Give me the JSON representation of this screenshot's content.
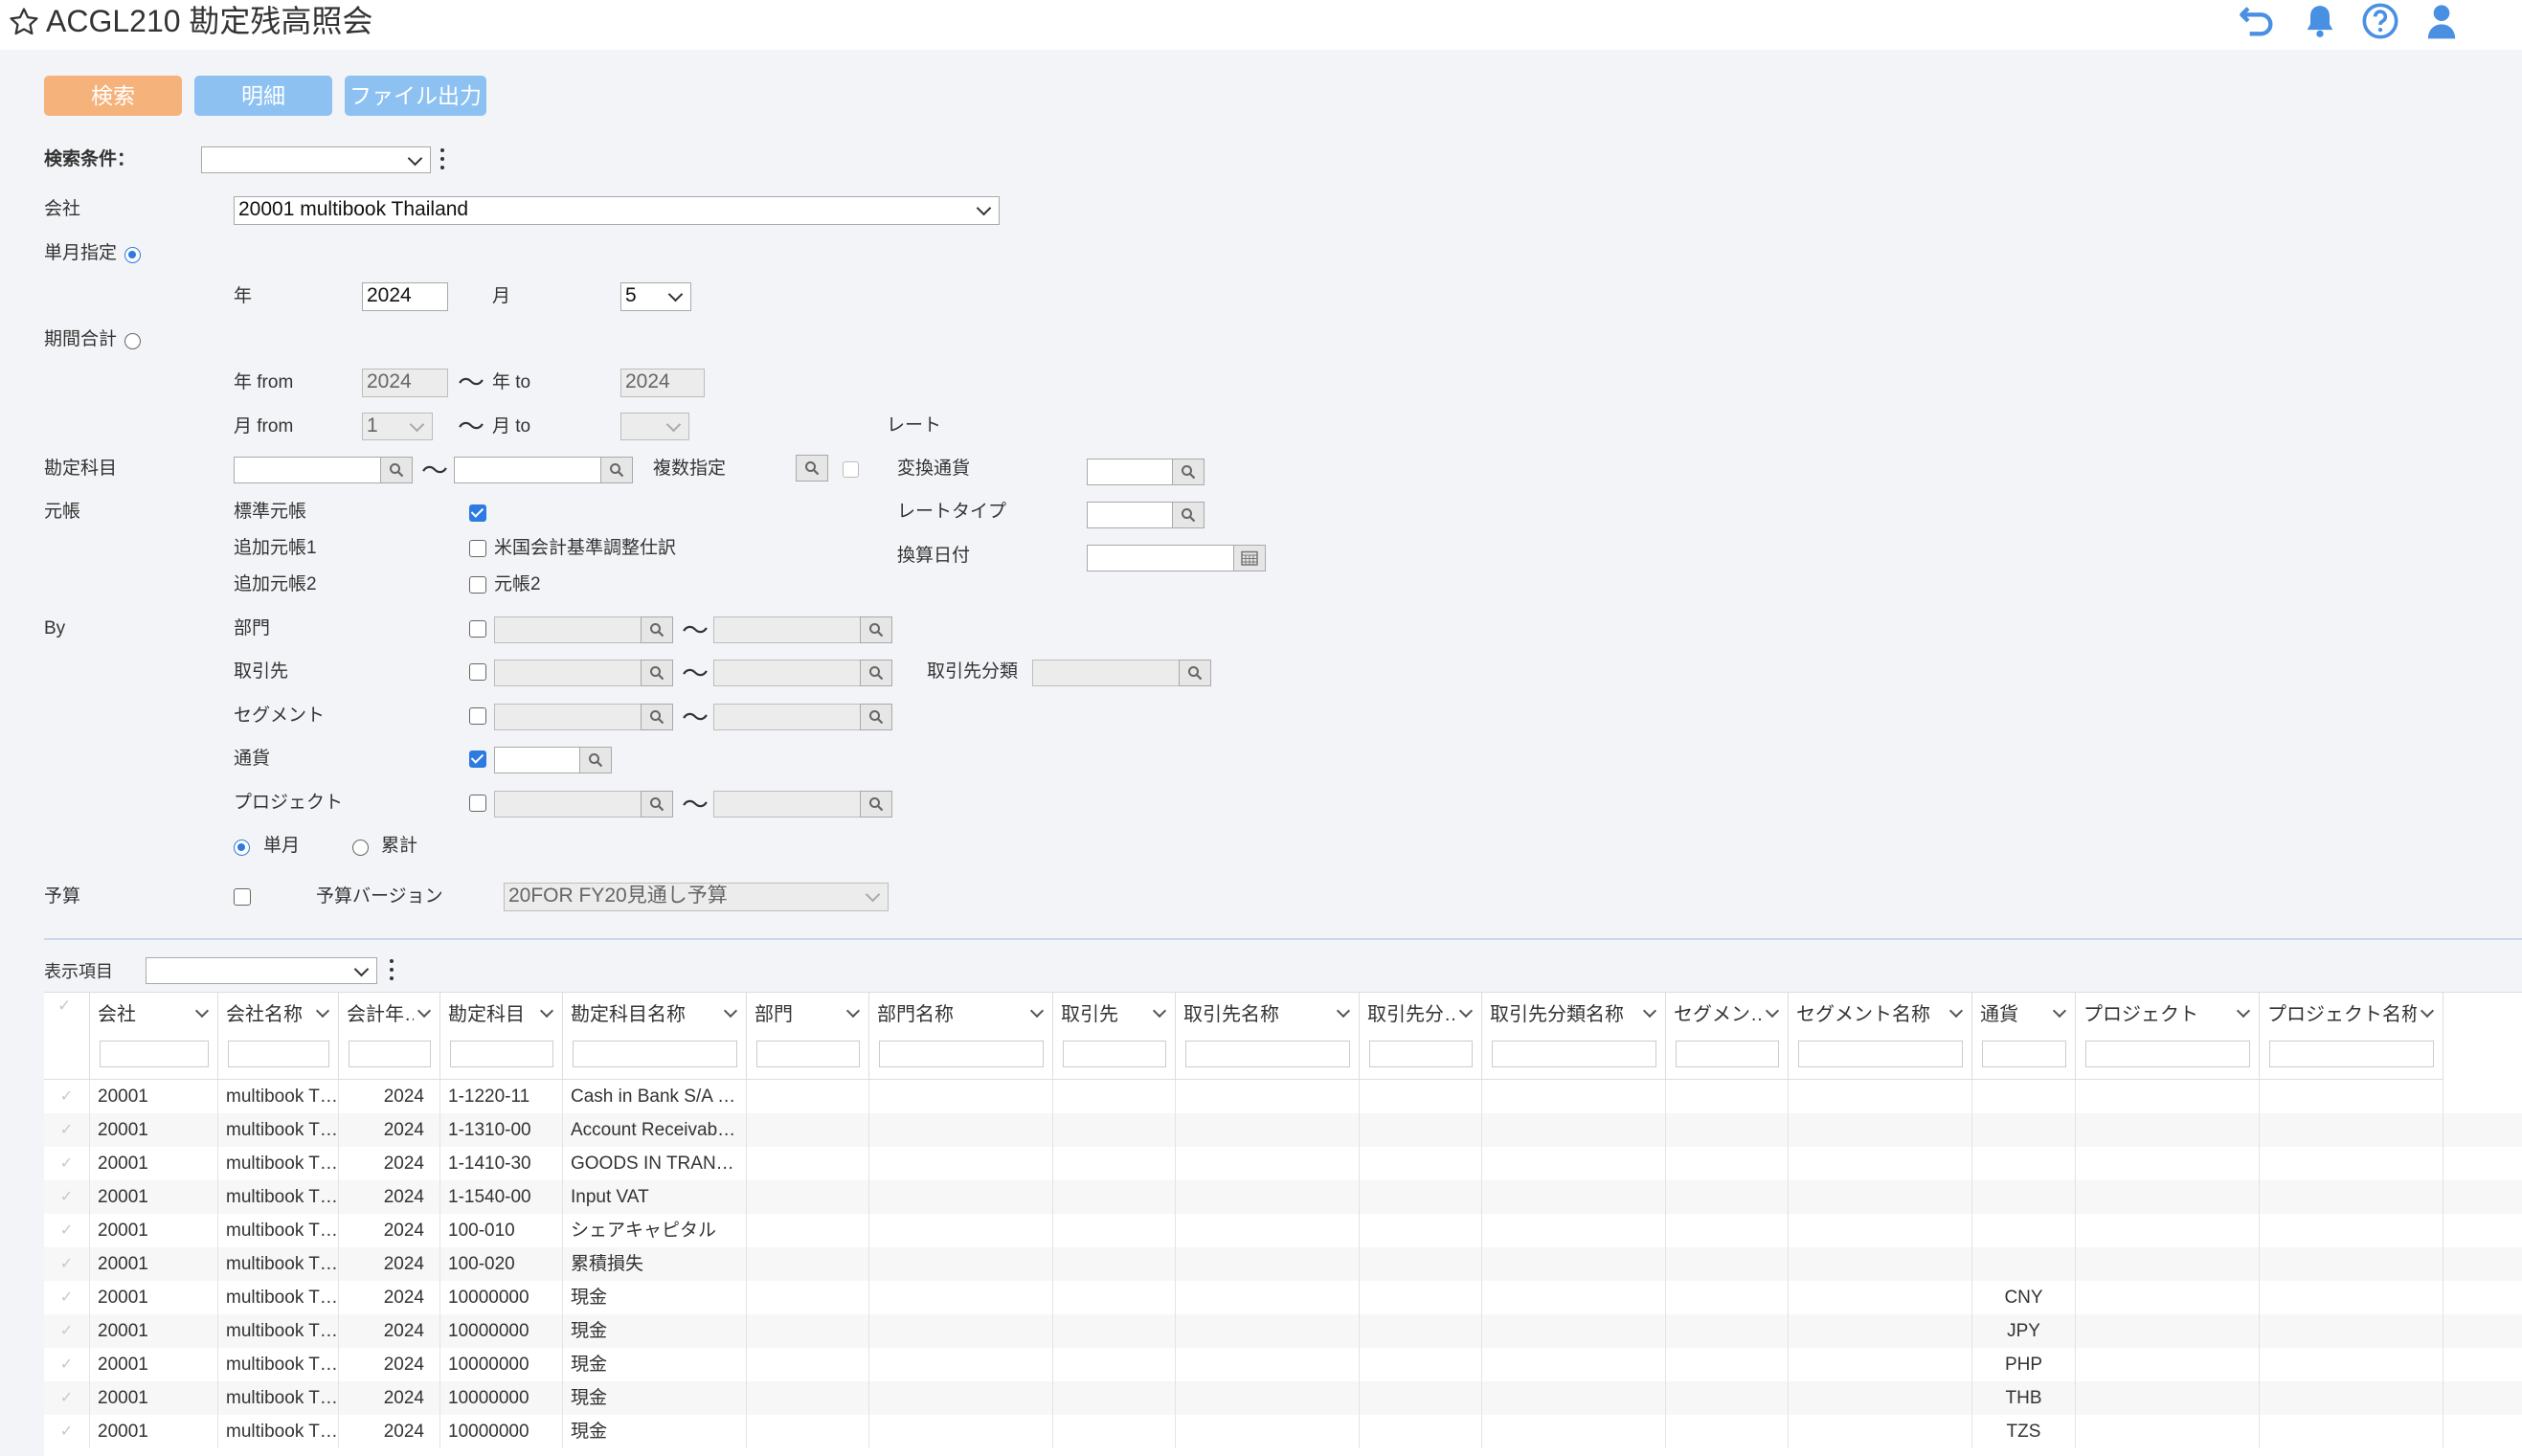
{
  "header": {
    "title": "ACGL210 勘定残高照会",
    "icons": [
      "star-icon",
      "undo-icon",
      "bell-icon",
      "help-icon",
      "user-icon"
    ],
    "accent": "#4a90e2"
  },
  "toolbar": {
    "search_label": "検索",
    "detail_label": "明細",
    "export_label": "ファイル出力",
    "search_color": "#f5b27a",
    "detail_color": "#8cc1f2"
  },
  "form": {
    "search_condition_label": "検索条件：",
    "search_condition_value": "",
    "company_label": "会社",
    "company_value": "20001 multibook Thailand",
    "single_month_label": "単月指定",
    "year_label": "年",
    "year_value": "2024",
    "month_label": "月",
    "month_value": "5",
    "period_total_label": "期間合計",
    "year_from_label": "年 from",
    "year_from_value": "2024",
    "year_to_label": "年 to",
    "year_to_value": "2024",
    "month_from_label": "月 from",
    "month_from_value": "1",
    "month_to_label": "月 to",
    "month_to_value": "",
    "tilde": "〜",
    "rate_label": "レート",
    "account_label": "勘定科目",
    "multi_label": "複数指定",
    "conv_currency_label": "変換通貨",
    "rate_type_label": "レートタイプ",
    "conv_date_label": "換算日付",
    "ledger_label": "元帳",
    "std_ledger_label": "標準元帳",
    "add_ledger1_label": "追加元帳1",
    "us_gaap_label": "米国会計基準調整仕訳",
    "add_ledger2_label": "追加元帳2",
    "ledger2_label": "元帳2",
    "by_label": "By",
    "dept_label": "部門",
    "partner_label": "取引先",
    "partner_class_label": "取引先分類",
    "segment_label": "セグメント",
    "currency_label": "通貨",
    "project_label": "プロジェクト",
    "single_label": "単月",
    "cumulative_label": "累計",
    "budget_label": "予算",
    "budget_version_label": "予算バージョン",
    "budget_version_value": "20FOR FY20見通し予算",
    "display_items_label": "表示項目",
    "display_items_value": ""
  },
  "grid": {
    "columns": [
      "会社",
      "会社名称",
      "会計年…",
      "勘定科目",
      "勘定科目名称",
      "部門",
      "部門名称",
      "取引先",
      "取引先名称",
      "取引先分…",
      "取引先分類名称",
      "セグメン…",
      "セグメント名称",
      "通貨",
      "プロジェクト",
      "プロジェクト名称…"
    ],
    "rows": [
      [
        "20001",
        "multibook Thailand",
        "2024",
        "1-1220-11",
        "Cash in Bank S/A …",
        "",
        "",
        "",
        "",
        "",
        "",
        "",
        "",
        "",
        "",
        ""
      ],
      [
        "20001",
        "multibook Thailand",
        "2024",
        "1-1310-00",
        "Account Receivab…",
        "",
        "",
        "",
        "",
        "",
        "",
        "",
        "",
        "",
        "",
        ""
      ],
      [
        "20001",
        "multibook Thailand",
        "2024",
        "1-1410-30",
        "GOODS IN TRAN…",
        "",
        "",
        "",
        "",
        "",
        "",
        "",
        "",
        "",
        "",
        ""
      ],
      [
        "20001",
        "multibook Thailand",
        "2024",
        "1-1540-00",
        "Input VAT",
        "",
        "",
        "",
        "",
        "",
        "",
        "",
        "",
        "",
        "",
        ""
      ],
      [
        "20001",
        "multibook Thailand",
        "2024",
        "100-010",
        "シェアキャピタル",
        "",
        "",
        "",
        "",
        "",
        "",
        "",
        "",
        "",
        "",
        ""
      ],
      [
        "20001",
        "multibook Thailand",
        "2024",
        "100-020",
        "累積損失",
        "",
        "",
        "",
        "",
        "",
        "",
        "",
        "",
        "",
        "",
        ""
      ],
      [
        "20001",
        "multibook Thailand",
        "2024",
        "10000000",
        "現金",
        "",
        "",
        "",
        "",
        "",
        "",
        "",
        "",
        "CNY",
        "",
        ""
      ],
      [
        "20001",
        "multibook Thailand",
        "2024",
        "10000000",
        "現金",
        "",
        "",
        "",
        "",
        "",
        "",
        "",
        "",
        "JPY",
        "",
        ""
      ],
      [
        "20001",
        "multibook Thailand",
        "2024",
        "10000000",
        "現金",
        "",
        "",
        "",
        "",
        "",
        "",
        "",
        "",
        "PHP",
        "",
        ""
      ],
      [
        "20001",
        "multibook Thailand",
        "2024",
        "10000000",
        "現金",
        "",
        "",
        "",
        "",
        "",
        "",
        "",
        "",
        "THB",
        "",
        ""
      ],
      [
        "20001",
        "multibook Thailand",
        "2024",
        "10000000",
        "現金",
        "",
        "",
        "",
        "",
        "",
        "",
        "",
        "",
        "TZS",
        "",
        ""
      ]
    ]
  }
}
